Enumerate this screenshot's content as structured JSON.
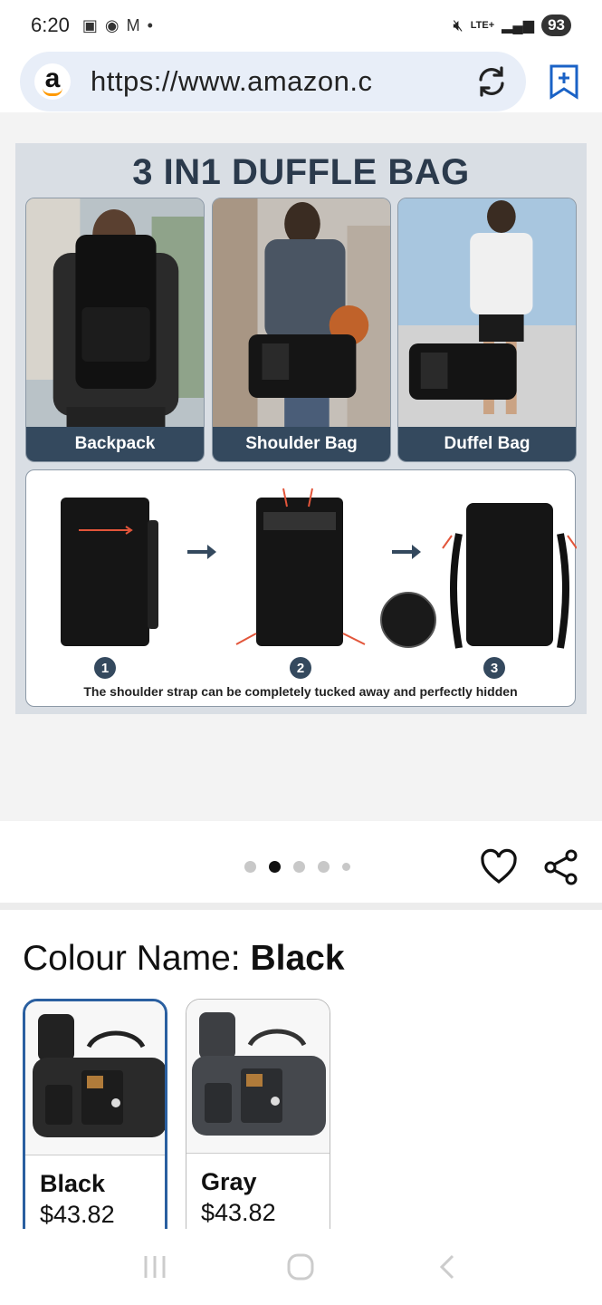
{
  "status_bar": {
    "time": "6:20",
    "battery": "93",
    "network": "LTE+"
  },
  "browser": {
    "url": "https://www.amazon.c",
    "logo_letter": "a"
  },
  "product_image": {
    "title": "3 IN1 DUFFLE BAG",
    "panels": [
      {
        "label": "Backpack"
      },
      {
        "label": "Shoulder Bag"
      },
      {
        "label": "Duffel Bag"
      }
    ],
    "steps": [
      "1",
      "2",
      "3"
    ],
    "caption": "The shoulder strap can be completely tucked away and perfectly hidden",
    "carousel_active_index": 1,
    "carousel_count": 5
  },
  "colour": {
    "label": "Colour Name: ",
    "selected": "Black",
    "options": [
      {
        "name": "Black",
        "price": "$43.82"
      },
      {
        "name": "Gray",
        "price": "$43.82"
      }
    ]
  },
  "colors": {
    "accent_selected": "#2a5fa0",
    "label_bar": "#34495e",
    "title_text": "#2b3a4c"
  }
}
